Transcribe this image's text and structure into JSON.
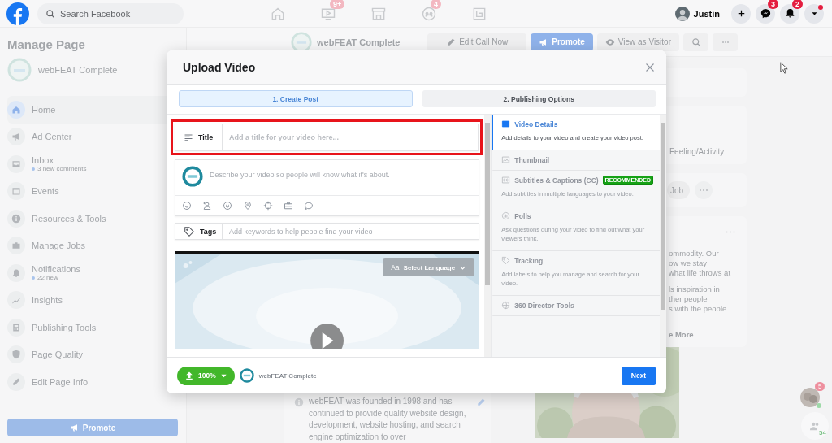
{
  "top_bar": {
    "search": {
      "placeholder": "Search Facebook"
    },
    "nav": [
      {
        "kind": "home"
      },
      {
        "kind": "video",
        "badge": "9+"
      },
      {
        "kind": "store"
      },
      {
        "kind": "groups",
        "badge": "4"
      },
      {
        "kind": "gaming"
      }
    ],
    "account": {
      "name": "Justin"
    },
    "actions": [
      {
        "kind": "plus"
      },
      {
        "kind": "messenger",
        "badge": "3"
      },
      {
        "kind": "bell",
        "badge": "2"
      },
      {
        "kind": "caret",
        "alert": true
      }
    ]
  },
  "sidebar": {
    "title": "Manage Page",
    "page_name": "webFEAT Complete",
    "items": [
      {
        "label": "Home",
        "selected": true
      },
      {
        "label": "Ad Center",
        "selected": false
      },
      {
        "label": "Inbox",
        "subtitle": "3 new comments",
        "selected": false
      },
      {
        "label": "Events",
        "selected": false
      },
      {
        "label": "Resources & Tools",
        "selected": false
      },
      {
        "label": "Manage Jobs",
        "selected": false
      },
      {
        "label": "Notifications",
        "subtitle": "22 new",
        "selected": false
      },
      {
        "label": "Insights",
        "selected": false
      },
      {
        "label": "Publishing Tools",
        "selected": false
      },
      {
        "label": "Page Quality",
        "selected": false
      },
      {
        "label": "Edit Page Info",
        "selected": false
      }
    ],
    "promote_button": "Promote"
  },
  "page_header": {
    "name": "webFEAT Complete",
    "buttons": [
      {
        "kind": "edit",
        "label": "Edit Call Now"
      },
      {
        "kind": "promote",
        "label": "Promote"
      },
      {
        "kind": "view",
        "label": "View as Visitor"
      },
      {
        "kind": "search"
      },
      {
        "kind": "more"
      }
    ]
  },
  "feed": {
    "activity_label": "Feeling/Activity",
    "job_button": "Job",
    "post_paragraphs": [
      [
        "ommodity. Our",
        "ow we stay",
        "what life throws at"
      ],
      [
        "ls inspiration in",
        "ther people",
        "s with the people"
      ]
    ],
    "see_more": "e More"
  },
  "about": {
    "text": "webFEAT was founded in 1998 and has continued to provide quality website design, development, website hosting, and search engine optimization to over"
  },
  "chat": {
    "unread_badge": "5",
    "online_count": "54"
  },
  "modal": {
    "title": "Upload Video",
    "tabs": [
      {
        "label": "1. Create Post",
        "selected": true
      },
      {
        "label": "2. Publishing Options",
        "selected": false
      }
    ],
    "title_field": {
      "label": "Title",
      "placeholder": "Add a title for your video here...",
      "highlighted": true
    },
    "description": {
      "placeholder": "Describe your video so people will know what it's about."
    },
    "tags_field": {
      "label": "Tags",
      "placeholder": "Add keywords to help people find your video"
    },
    "language_button": {
      "icon_text": "Aa",
      "label": "Select Language"
    },
    "steps": [
      {
        "title": "Video Details",
        "description": "Add details to your video and create your video post.",
        "selected": true
      },
      {
        "title": "Thumbnail",
        "selected": false
      },
      {
        "title": "Subtitles & Captions (CC)",
        "badge": "RECOMMENDED",
        "description": "Add subtitles in multiple languages to your video.",
        "selected": false
      },
      {
        "title": "Polls",
        "description": "Ask questions during your video to find out what your viewers think.",
        "selected": false
      },
      {
        "title": "Tracking",
        "description": "Add labels to help you manage and search for your video.",
        "selected": false
      },
      {
        "title": "360 Director Tools",
        "selected": false
      }
    ],
    "upload_button": "100%",
    "page_name": "webFEAT Complete",
    "next_button": "Next"
  }
}
